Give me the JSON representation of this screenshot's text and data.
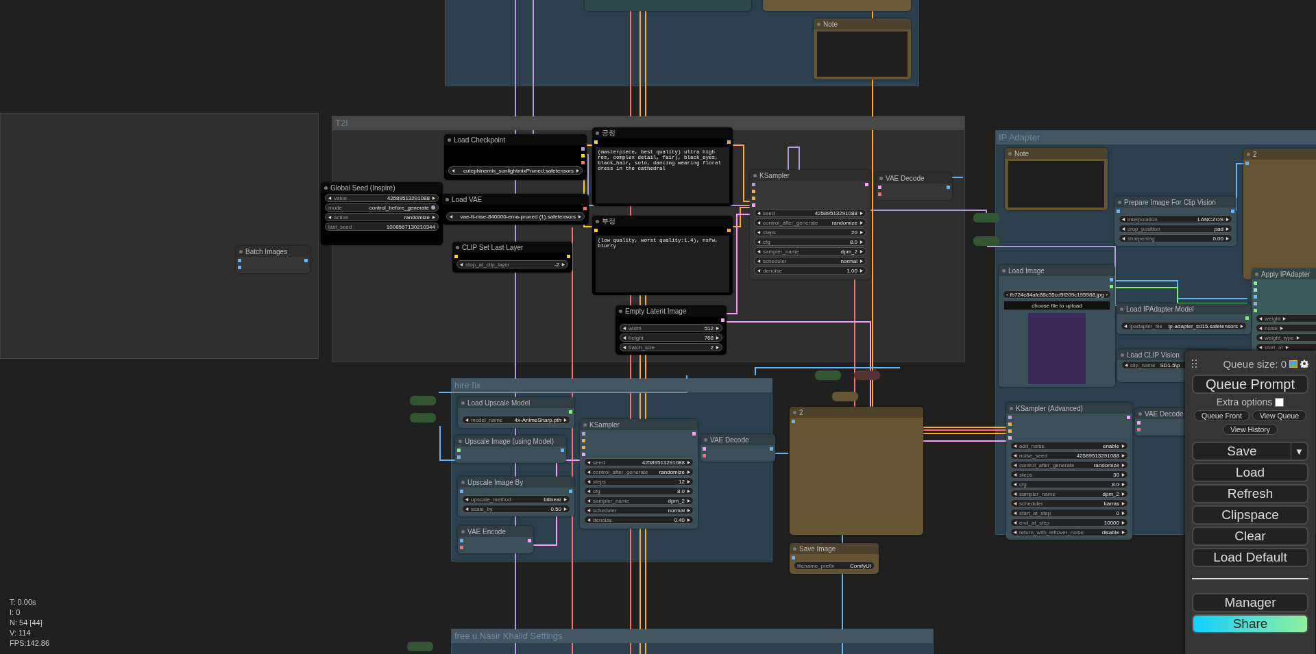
{
  "groups": [
    {
      "color": "#2b3f4c"
    },
    {
      "color": "#2f2f2f"
    },
    {
      "title": "T2I",
      "color": "#2f2f2f"
    },
    {
      "title": "IP Adapter",
      "color": "#2b3f4c"
    },
    {
      "title": "hire fix",
      "color": "#2b3f4c"
    },
    {
      "title": "free u Nasir Khalid Settings",
      "color": "#2b3f4c"
    }
  ],
  "reroutes": [
    {
      "color": "#335533"
    },
    {
      "color": "#335533"
    },
    {
      "color": "#335533"
    },
    {
      "color": "#553333"
    },
    {
      "color": "#665533"
    },
    {
      "color": "#335533"
    },
    {
      "color": "#335533"
    },
    {
      "color": "#335533"
    }
  ],
  "nodes": [
    {
      "kind": "stub",
      "color": "#2e4a48"
    },
    {
      "kind": "stub",
      "color": "#6b5a36"
    },
    {
      "kind": "note",
      "title": "Note",
      "color": "#665533"
    },
    {
      "kind": "node",
      "title": "Batch Images",
      "color": "#353535",
      "inputs": [
        {
          "color": "#64b5f6"
        },
        {
          "color": "#64b5f6"
        }
      ],
      "outputs": [
        {
          "color": "#64b5f6"
        }
      ]
    },
    {
      "kind": "node",
      "title": "Global Seed (Inspire)",
      "color": "#000000",
      "widgets": [
        {
          "kind": "number",
          "name": "value",
          "value": "42589513291088"
        },
        {
          "kind": "toggle",
          "name": "mode",
          "value": "control_before_generate"
        },
        {
          "kind": "combo",
          "name": "action",
          "value": "randomize"
        },
        {
          "kind": "readonly",
          "name": "last_seed",
          "value": "1008567130210344"
        }
      ]
    },
    {
      "kind": "node",
      "title": "Load Checkpoint",
      "color": "#000000",
      "outputs": [
        {
          "color": "#b39ddb"
        },
        {
          "color": "#ffd500"
        },
        {
          "color": "#ff6e6e"
        }
      ],
      "widgets": [
        {
          "kind": "combo",
          "value": "cutephinemix_sunlightmixPruned.safetensors"
        }
      ]
    },
    {
      "kind": "node",
      "title": "Load VAE",
      "color": "#000000",
      "outputs": [
        {
          "color": "#ff6e6e"
        }
      ],
      "widgets": [
        {
          "kind": "combo",
          "value": "vae-ft-mse-840000-ema-pruned (1).safetensors"
        }
      ]
    },
    {
      "kind": "node",
      "title": "CLIP Set Last Layer",
      "color": "#000000",
      "inputs": [
        {
          "color": "#ffd500"
        }
      ],
      "outputs": [
        {
          "color": "#ffd500"
        }
      ],
      "widgets": [
        {
          "kind": "number",
          "name": "stop_at_clip_layer",
          "value": "-2"
        }
      ]
    },
    {
      "kind": "prompt",
      "title": "긍정",
      "color": "#000000",
      "inputs": [
        {
          "color": "#ffd500"
        }
      ],
      "outputs": [
        {
          "color": "#ffa931"
        }
      ],
      "text": "(masterpiece, best quality) ultra high res, complex detail, fair), black_eyes, black_hair, solo, dancing wearing floral dress in the cathedral"
    },
    {
      "kind": "prompt",
      "title": "부정",
      "color": "#000000",
      "inputs": [
        {
          "color": "#ffd500"
        }
      ],
      "outputs": [
        {
          "color": "#ffa931"
        }
      ],
      "text": "(low quality, worst quality:1.4), nsfw, blurry"
    },
    {
      "kind": "node",
      "title": "Empty Latent Image",
      "color": "#000000",
      "outputs": [
        {
          "color": "#ff9cf9"
        }
      ],
      "widgets": [
        {
          "kind": "number",
          "name": "width",
          "value": "512"
        },
        {
          "kind": "number",
          "name": "height",
          "value": "768"
        },
        {
          "kind": "number",
          "name": "batch_size",
          "value": "2"
        }
      ]
    },
    {
      "kind": "node",
      "title": "KSampler",
      "color": "#353535",
      "inputs": [
        {
          "color": "#b39ddb"
        },
        {
          "color": "#ffa931"
        },
        {
          "color": "#ffa931"
        },
        {
          "color": "#ff9cf9"
        }
      ],
      "outputs": [
        {
          "color": "#ff9cf9"
        }
      ],
      "widgets": [
        {
          "kind": "number",
          "name": "seed",
          "value": "42589513291088"
        },
        {
          "kind": "combo",
          "name": "control_after_generate",
          "value": "randomize"
        },
        {
          "kind": "number",
          "name": "steps",
          "value": "20"
        },
        {
          "kind": "number",
          "name": "cfg",
          "value": "8.0"
        },
        {
          "kind": "combo",
          "name": "sampler_name",
          "value": "dpm_2"
        },
        {
          "kind": "combo",
          "name": "scheduler",
          "value": "normal"
        },
        {
          "kind": "number",
          "name": "denoise",
          "value": "1.00"
        }
      ]
    },
    {
      "kind": "node",
      "title": "VAE Decode",
      "color": "#353535",
      "inputs": [
        {
          "color": "#ff9cf9"
        },
        {
          "color": "#ff6e6e"
        }
      ],
      "outputs": [
        {
          "color": "#64b5f6"
        }
      ]
    },
    {
      "kind": "preview",
      "title": "2",
      "color": "#665533",
      "inputs": [
        {
          "color": "#64b5f6"
        }
      ]
    },
    {
      "kind": "node",
      "title": "Save Image",
      "color": "#665533",
      "inputs": [
        {
          "color": "#64b5f6"
        }
      ],
      "widgets": [
        {
          "kind": "text",
          "name": "filename_prefix",
          "value": "ComfyUI"
        }
      ]
    },
    {
      "kind": "node",
      "title": "Load Upscale Model",
      "color": "#3b4f58",
      "outputs": [
        {
          "color": "#7cf47c"
        }
      ],
      "widgets": [
        {
          "kind": "combo",
          "name": "model_name",
          "value": "4x-AnimeSharp.pth"
        }
      ]
    },
    {
      "kind": "node",
      "title": "Upscale Image (using Model)",
      "color": "#3b4f58",
      "inputs": [
        {
          "color": "#7cf47c"
        },
        {
          "color": "#64b5f6"
        }
      ],
      "outputs": [
        {
          "color": "#64b5f6"
        }
      ]
    },
    {
      "kind": "node",
      "title": "Upscale Image By",
      "color": "#3b4f58",
      "inputs": [
        {
          "color": "#64b5f6"
        }
      ],
      "outputs": [
        {
          "color": "#64b5f6"
        }
      ],
      "widgets": [
        {
          "kind": "combo",
          "name": "upscale_method",
          "value": "bilinear"
        },
        {
          "kind": "number",
          "name": "scale_by",
          "value": "0.50"
        }
      ]
    },
    {
      "kind": "node",
      "title": "VAE Encode",
      "color": "#3b4f58",
      "inputs": [
        {
          "color": "#64b5f6"
        },
        {
          "color": "#ff6e6e"
        }
      ],
      "outputs": [
        {
          "color": "#ff9cf9"
        }
      ]
    },
    {
      "kind": "node",
      "title": "KSampler",
      "color": "#3b4f58",
      "inputs": [
        {
          "color": "#b39ddb"
        },
        {
          "color": "#ffa931"
        },
        {
          "color": "#ffa931"
        },
        {
          "color": "#ff9cf9"
        }
      ],
      "outputs": [
        {
          "color": "#ff9cf9"
        }
      ],
      "widgets": [
        {
          "kind": "number",
          "name": "seed",
          "value": "42589513291088"
        },
        {
          "kind": "combo",
          "name": "control_after_generate",
          "value": "randomize"
        },
        {
          "kind": "number",
          "name": "steps",
          "value": "12"
        },
        {
          "kind": "number",
          "name": "cfg",
          "value": "8.0"
        },
        {
          "kind": "combo",
          "name": "sampler_name",
          "value": "dpm_2"
        },
        {
          "kind": "combo",
          "name": "scheduler",
          "value": "normal"
        },
        {
          "kind": "number",
          "name": "denoise",
          "value": "0.40"
        }
      ]
    },
    {
      "kind": "node",
      "title": "VAE Decode",
      "color": "#3b4f58",
      "inputs": [
        {
          "color": "#ff9cf9"
        },
        {
          "color": "#ff6e6e"
        }
      ],
      "outputs": [
        {
          "color": "#64b5f6"
        }
      ]
    },
    {
      "kind": "note",
      "title": "Note",
      "color": "#665533"
    },
    {
      "kind": "node",
      "title": "Prepare Image For Clip Vision",
      "color": "#3b4f58",
      "inputs": [
        {
          "color": "#64b5f6"
        }
      ],
      "outputs": [
        {
          "color": "#64b5f6"
        }
      ],
      "widgets": [
        {
          "kind": "combo",
          "name": "interpolation",
          "value": "LANCZOS"
        },
        {
          "kind": "combo",
          "name": "crop_position",
          "value": "pad"
        },
        {
          "kind": "number",
          "name": "sharpening",
          "value": "0.00"
        }
      ]
    },
    {
      "kind": "preview",
      "title": "2",
      "color": "#665533",
      "inputs": [
        {
          "color": "#64b5f6"
        }
      ]
    },
    {
      "kind": "node",
      "title": "Load Image",
      "color": "#3b4f58",
      "outputs": [
        {
          "color": "#64b5f6"
        },
        {
          "color": "#7cf47c"
        }
      ],
      "widgets": [
        {
          "kind": "combo",
          "value": "fb724c84afc88c35cd9f209c195988.jpg"
        },
        {
          "kind": "button",
          "value": "choose file to upload"
        },
        {
          "kind": "image"
        }
      ]
    },
    {
      "kind": "node",
      "title": "Apply IPAdapter",
      "color": "#3b5a5a",
      "inputs": [
        {
          "color": "#7cf47c"
        },
        {
          "color": "#a0dcdc"
        },
        {
          "color": "#64b5f6"
        },
        {
          "color": "#b39ddb"
        },
        {
          "color": "#7cf47c"
        }
      ],
      "widgets": [
        {
          "kind": "number",
          "name": "weight"
        },
        {
          "kind": "number",
          "name": "noise"
        },
        {
          "kind": "combo",
          "name": "weight_type"
        },
        {
          "kind": "number",
          "name": "start_at"
        }
      ]
    },
    {
      "kind": "node",
      "title": "Load IPAdapter Model",
      "color": "#3b4f58",
      "outputs": [
        {
          "color": "#7cf47c"
        }
      ],
      "widgets": [
        {
          "kind": "combo",
          "name": "ipadapter_file",
          "value": "ip-adapter_sd15.safetensors"
        }
      ]
    },
    {
      "kind": "node",
      "title": "Load CLIP Vision",
      "color": "#3b4f58",
      "widgets": [
        {
          "kind": "combo",
          "name": "clip_name",
          "value": "SD1.5\\p"
        }
      ]
    },
    {
      "kind": "node",
      "title": "KSampler (Advanced)",
      "color": "#3b4f58",
      "inputs": [
        {
          "color": "#b39ddb"
        },
        {
          "color": "#ffa931"
        },
        {
          "color": "#ffa931"
        },
        {
          "color": "#ff9cf9"
        }
      ],
      "outputs": [
        {
          "color": "#ff9cf9"
        }
      ],
      "widgets": [
        {
          "kind": "combo",
          "name": "add_noise",
          "value": "enable"
        },
        {
          "kind": "number",
          "name": "noise_seed",
          "value": "42589513291088"
        },
        {
          "kind": "combo",
          "name": "control_after_generate",
          "value": "randomize"
        },
        {
          "kind": "number",
          "name": "steps",
          "value": "30"
        },
        {
          "kind": "number",
          "name": "cfg",
          "value": "8.0"
        },
        {
          "kind": "combo",
          "name": "sampler_name",
          "value": "dpm_2"
        },
        {
          "kind": "combo",
          "name": "scheduler",
          "value": "karras"
        },
        {
          "kind": "number",
          "name": "start_at_step",
          "value": "0"
        },
        {
          "kind": "number",
          "name": "end_at_step",
          "value": "10000"
        },
        {
          "kind": "combo",
          "name": "return_with_leftover_noise",
          "value": "disable"
        }
      ]
    },
    {
      "kind": "node",
      "title": "VAE Decode",
      "color": "#3b4f58",
      "inputs": [
        {
          "color": "#ff9cf9"
        },
        {
          "color": "#ff6e6e"
        }
      ]
    }
  ],
  "menu": {
    "queue_size": "Queue size: 0",
    "queue_button": "Queue Prompt",
    "extra_options": {
      "label": "Extra options",
      "checked": false
    },
    "small_buttons": [
      "Queue Front",
      "View Queue",
      "View History"
    ],
    "buttons": [
      {
        "kind": "split",
        "label": "Save",
        "caret": "▼"
      },
      {
        "kind": "plain",
        "label": "Load"
      },
      {
        "kind": "plain",
        "label": "Refresh"
      },
      {
        "kind": "plain",
        "label": "Clipspace"
      },
      {
        "kind": "plain",
        "label": "Clear"
      },
      {
        "kind": "plain",
        "label": "Load Default"
      },
      {
        "kind": "divider"
      },
      {
        "kind": "plain",
        "label": "Manager"
      },
      {
        "kind": "gradient",
        "label": "Share"
      }
    ]
  },
  "stats": [
    "T: 0.00s",
    "I: 0",
    "N: 54 [44]",
    "V: 114",
    "FPS:142.86"
  ]
}
